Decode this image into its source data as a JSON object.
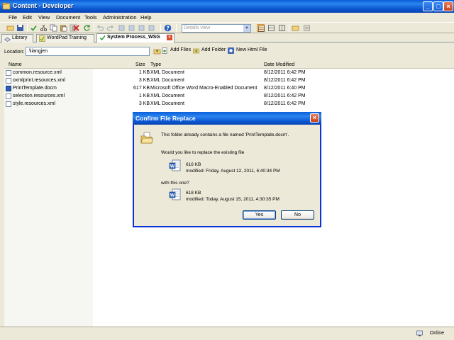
{
  "window": {
    "title": "Content - Developer",
    "minimize_label": "_",
    "maximize_label": "□",
    "close_label": "×"
  },
  "menu": [
    {
      "label": "File"
    },
    {
      "label": "Edit"
    },
    {
      "label": "View"
    },
    {
      "label": "Document"
    },
    {
      "label": "Tools"
    },
    {
      "label": "Administration"
    },
    {
      "label": "Help"
    }
  ],
  "toolbar": {
    "view_select": "Details view",
    "view_arrow": "▼"
  },
  "tabs": [
    {
      "label": "Library"
    },
    {
      "label": "WordPad Training"
    },
    {
      "label": "System Process_WSG"
    }
  ],
  "tab_close_label": "×",
  "location": {
    "label": "Location:",
    "value": ".\\liangjen",
    "add_files": "Add Files",
    "add_folder": "Add Folder",
    "new_html_file": "New Html File"
  },
  "columns": {
    "name": "Name",
    "size": "Size",
    "type": "Type",
    "date_modified": "Date Modified"
  },
  "files": [
    {
      "name": "common.resource.xml",
      "size": "1 KB",
      "type": "XML Document",
      "date": "8/12/2011 6:42 PM"
    },
    {
      "name": "oxmlprint.resources.xml",
      "size": "3 KB",
      "type": "XML Document",
      "date": "8/12/2011 6:42 PM"
    },
    {
      "name": "PrintTemplate.docm",
      "size": "617 KB",
      "type": "Microsoft Office Word Macro-Enabled Document",
      "date": "8/12/2011 6:40 PM"
    },
    {
      "name": "selection.resources.xml",
      "size": "1 KB",
      "type": "XML Document",
      "date": "8/12/2011 6:42 PM"
    },
    {
      "name": "style.resources.xml",
      "size": "3 KB",
      "type": "XML Document",
      "date": "8/12/2011 6:42 PM"
    }
  ],
  "status": {
    "online": "Online"
  },
  "dialog": {
    "title": "Confirm File Replace",
    "close_label": "×",
    "message": "This folder already contains a file named 'PrintTemplate.docm'.",
    "question": "Would you like to replace the existing file",
    "existing_size": "616 KB",
    "existing_modified": "modified: Friday, August 12, 2011, 6:40:34 PM",
    "with_label": "with this one?",
    "new_size": "618 KB",
    "new_modified": "modified: Today, August 15, 2011, 4:30:35 PM",
    "yes_label": "Yes",
    "no_label": "No"
  }
}
